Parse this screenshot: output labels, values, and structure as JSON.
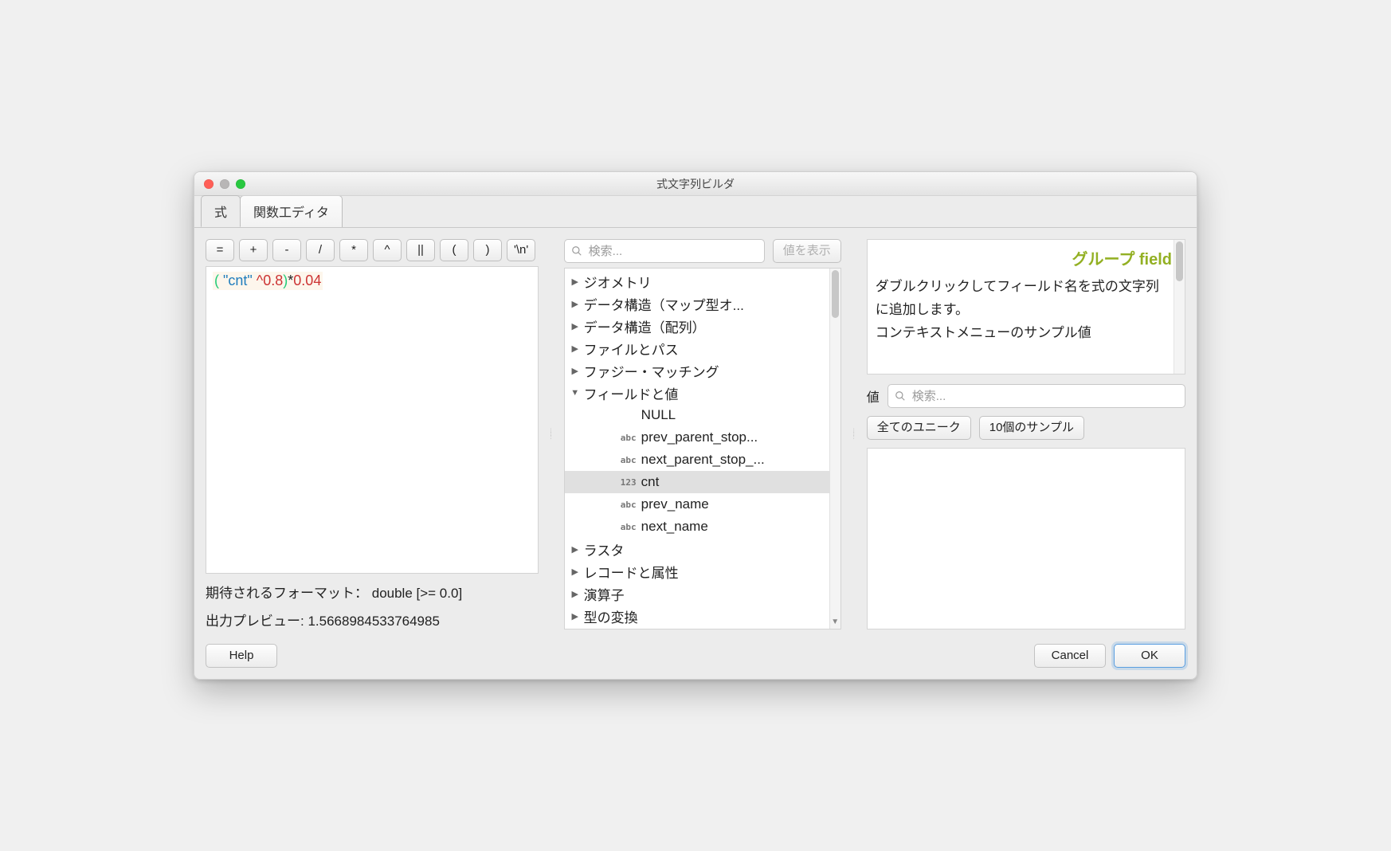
{
  "window": {
    "title": "式文字列ビルダ"
  },
  "tabs": {
    "expr": "式",
    "funcEditor": "関数工ディタ"
  },
  "operators": [
    "=",
    "+",
    "-",
    "/",
    "*",
    "^",
    "||",
    "(",
    ")",
    "'\\n'"
  ],
  "expression": {
    "tokens": [
      {
        "t": "(",
        "c": "parenL"
      },
      {
        "t": " \"cnt\" ",
        "c": "string"
      },
      {
        "t": "^",
        "c": "op"
      },
      {
        "t": "0.8",
        "c": "num"
      },
      {
        "t": ")",
        "c": "parenR"
      },
      {
        "t": "*",
        "c": "black"
      },
      {
        "t": "0.04",
        "c": "num"
      }
    ]
  },
  "status": {
    "expectedLabel": "期待されるフォーマット：",
    "expectedValue": "double [>= 0.0]",
    "previewLabel": "出力プレビュー:",
    "previewValue": "1.5668984533764985"
  },
  "middle": {
    "searchPlaceholder": "検索...",
    "showValues": "値を表示"
  },
  "tree": [
    {
      "label": "ジオメトリ",
      "arrow": "right",
      "indent": 0
    },
    {
      "label": "データ構造（マップ型オ...",
      "arrow": "right",
      "indent": 0
    },
    {
      "label": "データ構造（配列）",
      "arrow": "right",
      "indent": 0
    },
    {
      "label": "ファイルとパス",
      "arrow": "right",
      "indent": 0
    },
    {
      "label": "ファジー・マッチング",
      "arrow": "right",
      "indent": 0
    },
    {
      "label": "フィールドと値",
      "arrow": "down",
      "indent": 0
    },
    {
      "label": "NULL",
      "arrow": "",
      "indent": 2,
      "type": ""
    },
    {
      "label": "prev_parent_stop...",
      "arrow": "",
      "indent": 2,
      "type": "abc"
    },
    {
      "label": "next_parent_stop_...",
      "arrow": "",
      "indent": 2,
      "type": "abc"
    },
    {
      "label": "cnt",
      "arrow": "",
      "indent": 2,
      "type": "123",
      "selected": true
    },
    {
      "label": "prev_name",
      "arrow": "",
      "indent": 2,
      "type": "abc"
    },
    {
      "label": "next_name",
      "arrow": "",
      "indent": 2,
      "type": "abc"
    },
    {
      "label": "ラスタ",
      "arrow": "right",
      "indent": 0
    },
    {
      "label": "レコードと属性",
      "arrow": "right",
      "indent": 0
    },
    {
      "label": "演算子",
      "arrow": "right",
      "indent": 0
    },
    {
      "label": "型の変換",
      "arrow": "right",
      "indent": 0
    }
  ],
  "help": {
    "title_prefix": "グループ ",
    "title_accent": "field",
    "body_line1": "ダブルクリックしてフィールド名を式の文字列に追加します。",
    "body_line2": "コンテキストメニューのサンプル値"
  },
  "values": {
    "label": "値",
    "searchPlaceholder": "検索...",
    "allUnique": "全てのユニーク",
    "tenSamples": "10個のサンプル"
  },
  "footer": {
    "help": "Help",
    "cancel": "Cancel",
    "ok": "OK"
  }
}
